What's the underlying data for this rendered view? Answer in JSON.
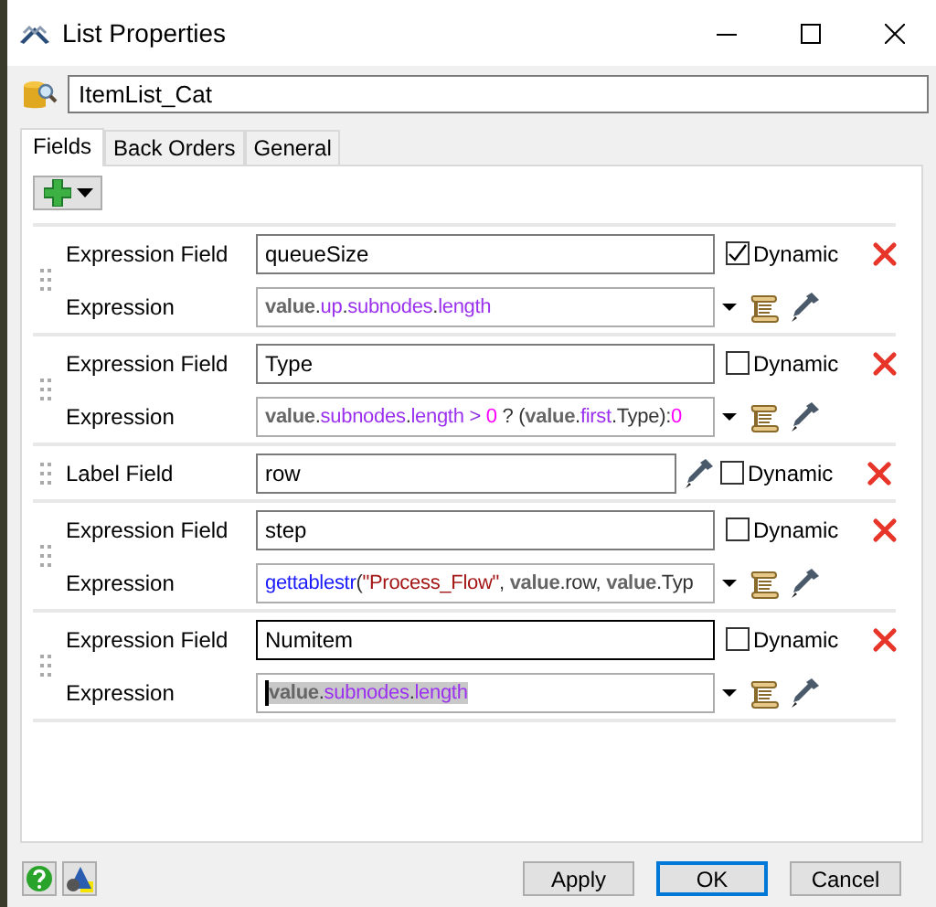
{
  "window": {
    "title": "List Properties"
  },
  "list_name": "ItemList_Cat",
  "tabs": [
    {
      "label": "Fields",
      "selected": true
    },
    {
      "label": "Back Orders",
      "selected": false
    },
    {
      "label": "General",
      "selected": false
    }
  ],
  "fields": [
    {
      "kind": "expression",
      "label": "Expression Field",
      "value": "queueSize",
      "focused": false,
      "dynamic": true,
      "dynamic_label": "Dynamic",
      "expression_label": "Expression",
      "text_selected": false,
      "expression": [
        {
          "kind": "keyword",
          "text": "value"
        },
        {
          "kind": "plain",
          "text": "."
        },
        {
          "kind": "property",
          "text": "up"
        },
        {
          "kind": "plain",
          "text": "."
        },
        {
          "kind": "property",
          "text": "subnodes"
        },
        {
          "kind": "plain",
          "text": "."
        },
        {
          "kind": "property",
          "text": "length"
        }
      ]
    },
    {
      "kind": "expression",
      "label": "Expression Field",
      "value": "Type",
      "focused": false,
      "dynamic": false,
      "dynamic_label": "Dynamic",
      "expression_label": "Expression",
      "text_selected": false,
      "expression": [
        {
          "kind": "keyword",
          "text": "value"
        },
        {
          "kind": "plain",
          "text": "."
        },
        {
          "kind": "property",
          "text": "subnodes"
        },
        {
          "kind": "plain",
          "text": "."
        },
        {
          "kind": "property",
          "text": "length"
        },
        {
          "kind": "operator",
          "text": " > "
        },
        {
          "kind": "number",
          "text": "0"
        },
        {
          "kind": "plain",
          "text": " ? ("
        },
        {
          "kind": "keyword",
          "text": "value"
        },
        {
          "kind": "plain",
          "text": "."
        },
        {
          "kind": "property",
          "text": "first"
        },
        {
          "kind": "plain",
          "text": ".Type):"
        },
        {
          "kind": "number",
          "text": "0"
        }
      ]
    },
    {
      "kind": "label",
      "label": "Label Field",
      "value": "row",
      "focused": false,
      "dynamic": false,
      "dynamic_label": "Dynamic"
    },
    {
      "kind": "expression",
      "label": "Expression Field",
      "value": "step",
      "focused": false,
      "dynamic": false,
      "dynamic_label": "Dynamic",
      "expression_label": "Expression",
      "text_selected": false,
      "expression": [
        {
          "kind": "function",
          "text": "gettablestr"
        },
        {
          "kind": "plain",
          "text": "("
        },
        {
          "kind": "string",
          "text": "\"Process_Flow\""
        },
        {
          "kind": "plain",
          "text": ", "
        },
        {
          "kind": "keyword",
          "text": "value"
        },
        {
          "kind": "plain",
          "text": ".row, "
        },
        {
          "kind": "keyword",
          "text": "value"
        },
        {
          "kind": "plain",
          "text": ".Typ"
        }
      ]
    },
    {
      "kind": "expression",
      "label": "Expression Field",
      "value": "Numitem",
      "focused": true,
      "dynamic": false,
      "dynamic_label": "Dynamic",
      "expression_label": "Expression",
      "text_selected": true,
      "expression": [
        {
          "kind": "keyword",
          "text": "value"
        },
        {
          "kind": "plain",
          "text": "."
        },
        {
          "kind": "property",
          "text": "subnodes"
        },
        {
          "kind": "plain",
          "text": "."
        },
        {
          "kind": "property",
          "text": "length"
        }
      ]
    }
  ],
  "buttons": [
    {
      "label": "Apply",
      "default": false
    },
    {
      "label": "OK",
      "default": true
    },
    {
      "label": "Cancel",
      "default": false
    }
  ]
}
